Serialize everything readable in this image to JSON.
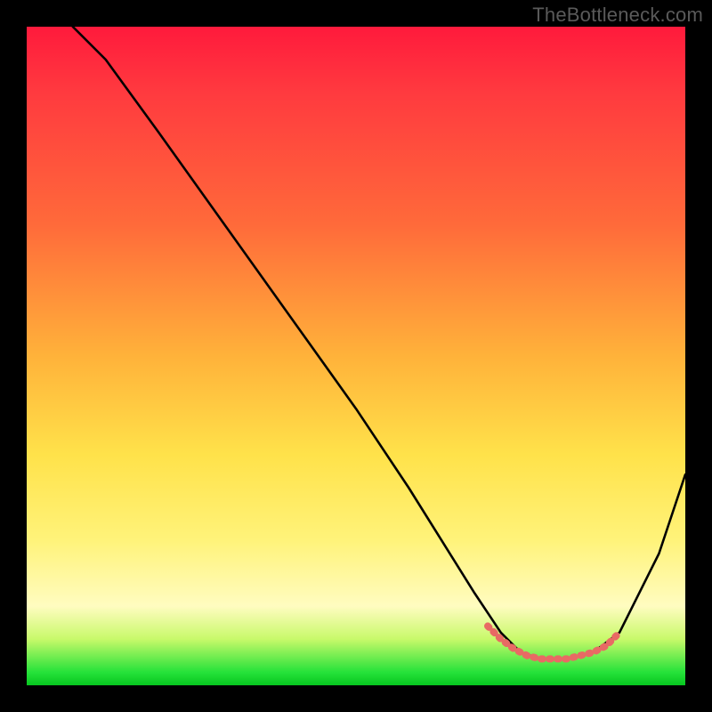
{
  "watermark": "TheBottleneck.com",
  "chart_data": {
    "type": "line",
    "title": "",
    "xlabel": "",
    "ylabel": "",
    "xlim": [
      0,
      100
    ],
    "ylim": [
      0,
      100
    ],
    "grid": false,
    "legend": false,
    "series": [
      {
        "name": "black-curve",
        "color": "#000000",
        "x": [
          7,
          12,
          20,
          30,
          40,
          50,
          58,
          63,
          68,
          72,
          75,
          78,
          82,
          86,
          90,
          96,
          100
        ],
        "values": [
          100,
          95,
          84,
          70,
          56,
          42,
          30,
          22,
          14,
          8,
          5,
          4,
          4,
          5,
          8,
          20,
          32
        ]
      },
      {
        "name": "red-highlight",
        "color": "#e86a64",
        "x": [
          70,
          72,
          74,
          76,
          78,
          80,
          82,
          84,
          86,
          88,
          90
        ],
        "values": [
          9,
          7,
          5.5,
          4.5,
          4,
          4,
          4,
          4.5,
          5,
          6,
          8
        ]
      }
    ],
    "annotations": []
  }
}
